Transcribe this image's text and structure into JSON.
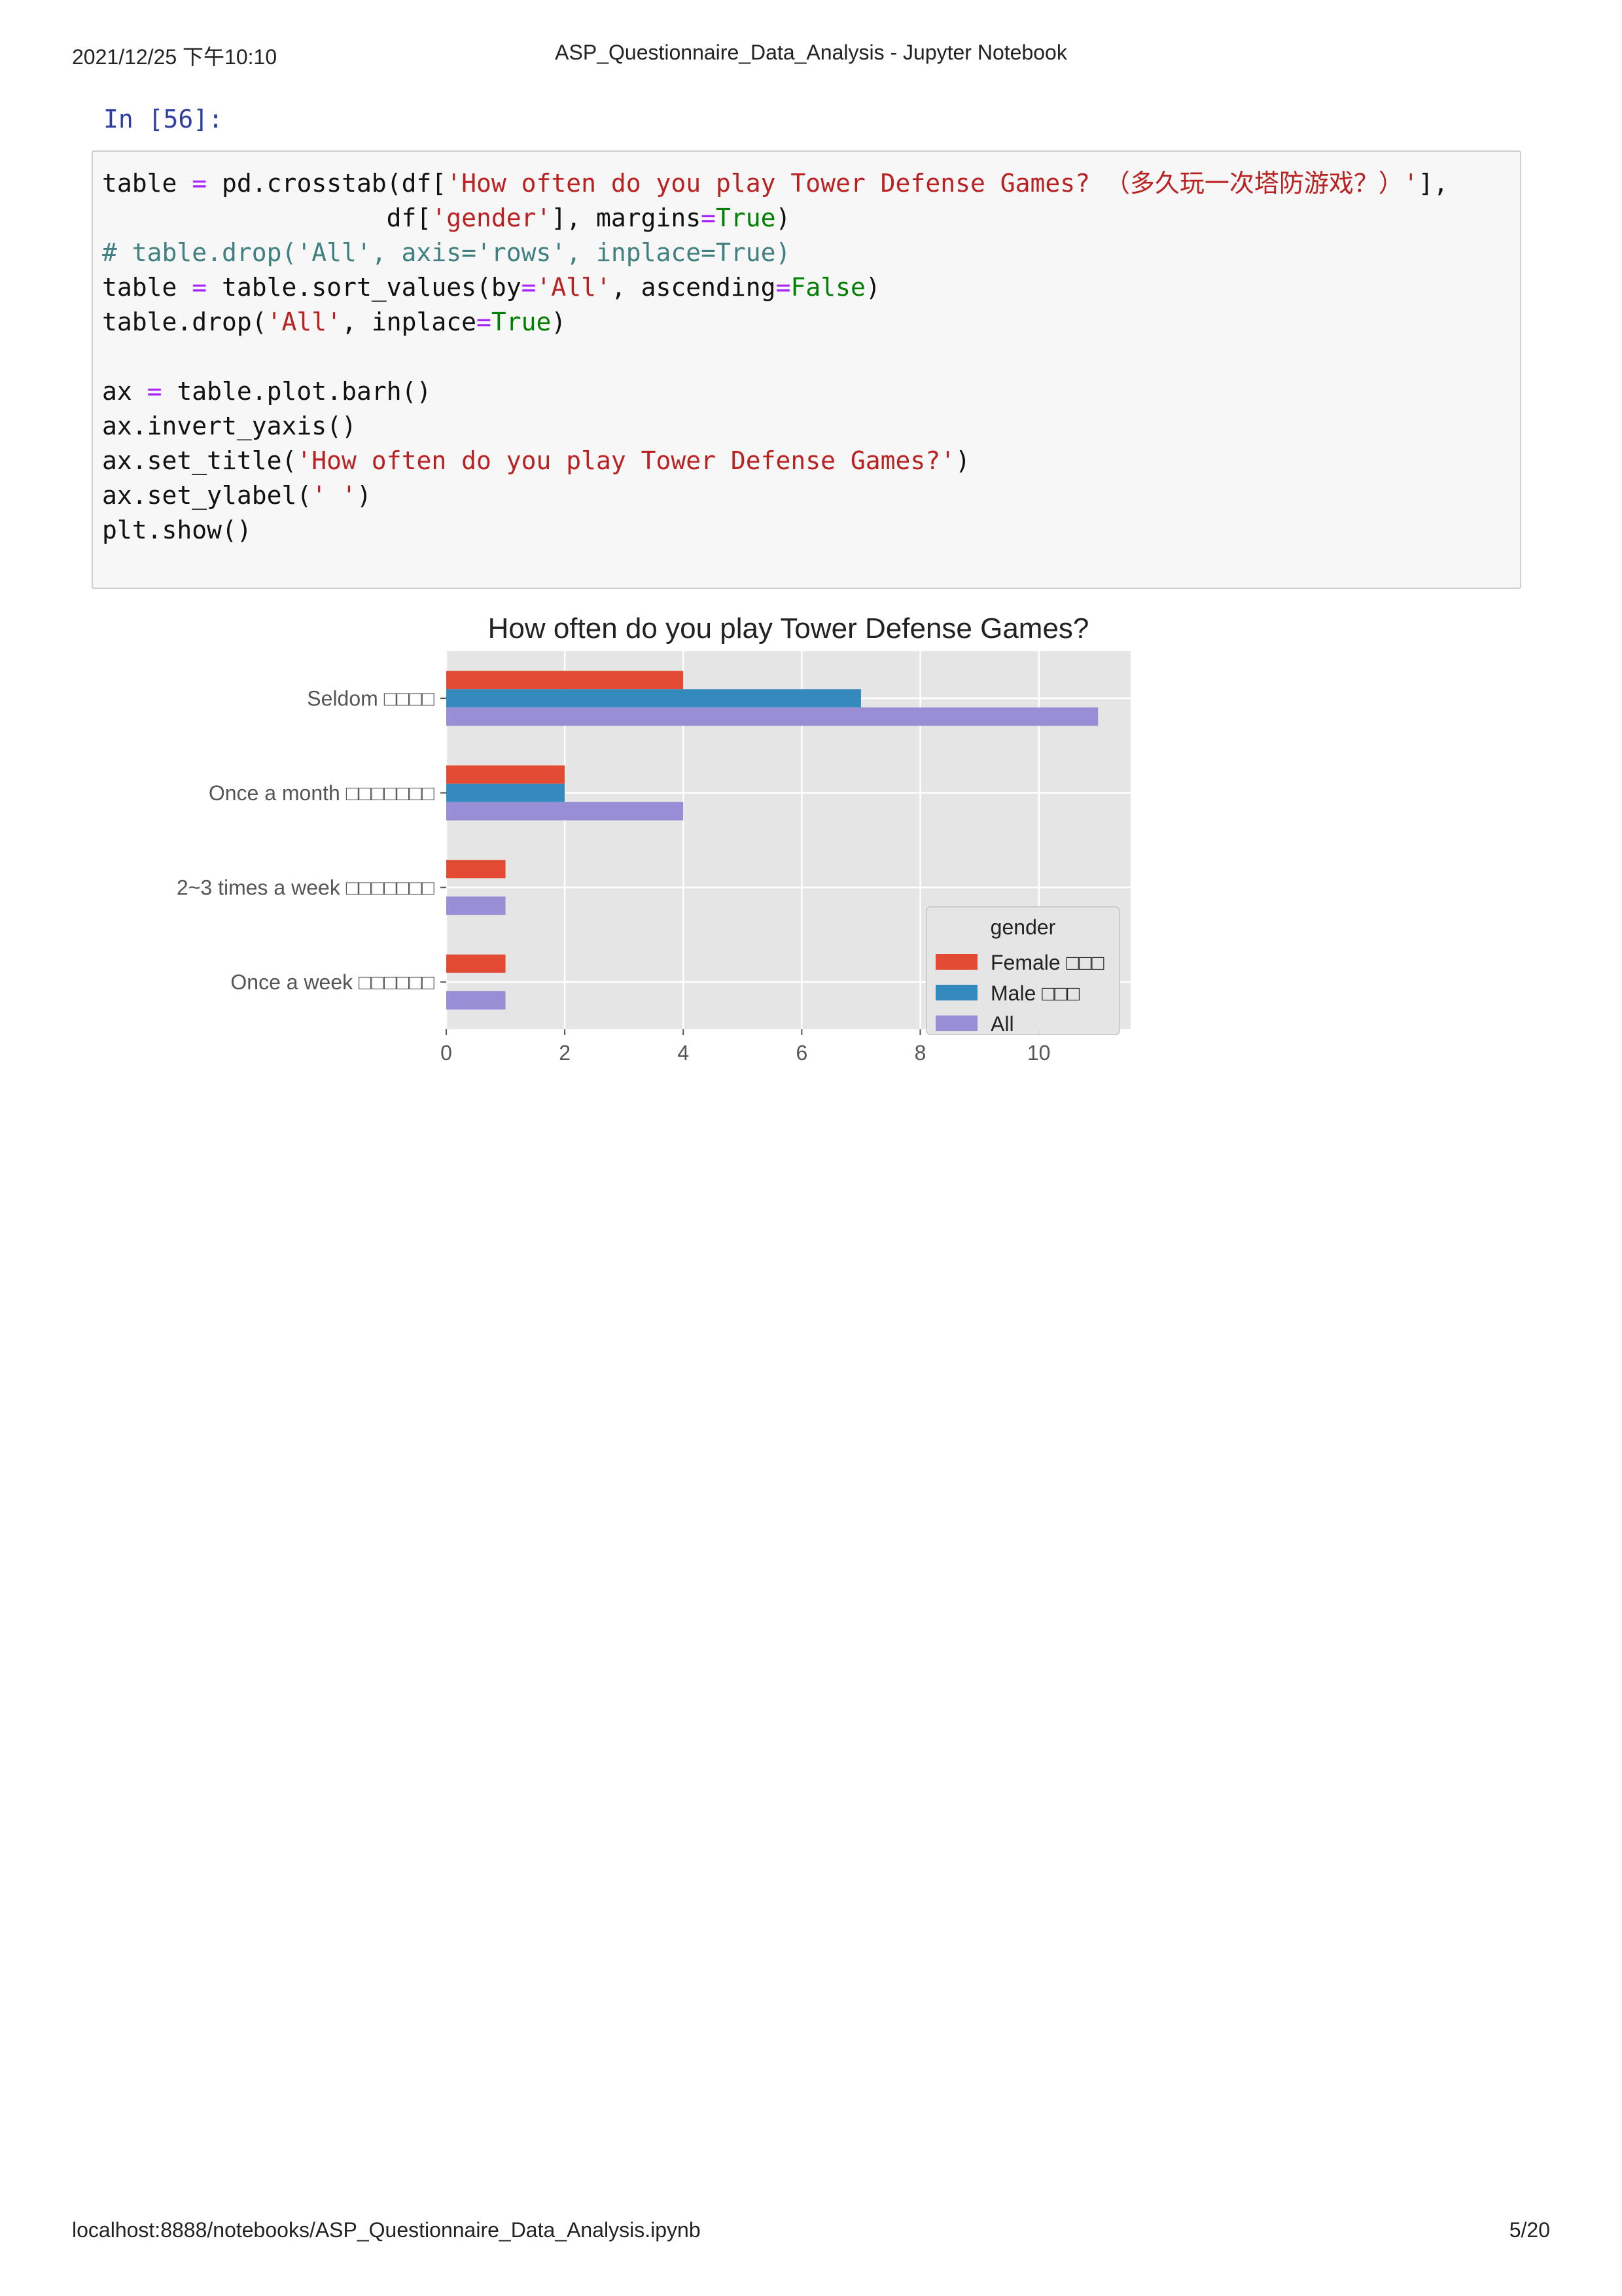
{
  "header": {
    "datetime": "2021/12/25 下午10:10",
    "title": "ASP_Questionnaire_Data_Analysis - Jupyter Notebook"
  },
  "footer": {
    "url": "localhost:8888/notebooks/ASP_Questionnaire_Data_Analysis.ipynb",
    "page": "5/20"
  },
  "cell": {
    "prompt": "In  [56]:",
    "code_lines": [
      [
        {
          "t": "table "
        },
        {
          "t": "=",
          "c": "op"
        },
        {
          "t": " pd.crosstab(df["
        },
        {
          "t": "'How often do you play Tower Defense Games? （多久玩一次塔防游戏？）'",
          "c": "str"
        },
        {
          "t": "],"
        }
      ],
      [
        {
          "t": "                   df["
        },
        {
          "t": "'gender'",
          "c": "str"
        },
        {
          "t": "], margins"
        },
        {
          "t": "=",
          "c": "op"
        },
        {
          "t": "True",
          "c": "kw"
        },
        {
          "t": ")"
        }
      ],
      [
        {
          "t": "# table.drop('All', axis='rows', inplace=True)",
          "c": "com"
        }
      ],
      [
        {
          "t": "table "
        },
        {
          "t": "=",
          "c": "op"
        },
        {
          "t": " table.sort_values(by"
        },
        {
          "t": "=",
          "c": "op"
        },
        {
          "t": "'All'",
          "c": "str"
        },
        {
          "t": ", ascending"
        },
        {
          "t": "=",
          "c": "op"
        },
        {
          "t": "False",
          "c": "kw"
        },
        {
          "t": ")"
        }
      ],
      [
        {
          "t": "table.drop("
        },
        {
          "t": "'All'",
          "c": "str"
        },
        {
          "t": ", inplace"
        },
        {
          "t": "=",
          "c": "op"
        },
        {
          "t": "True",
          "c": "kw"
        },
        {
          "t": ")"
        }
      ],
      [
        {
          "t": ""
        }
      ],
      [
        {
          "t": "ax "
        },
        {
          "t": "=",
          "c": "op"
        },
        {
          "t": " table.plot.barh()"
        }
      ],
      [
        {
          "t": "ax.invert_yaxis()"
        }
      ],
      [
        {
          "t": "ax.set_title("
        },
        {
          "t": "'How often do you play Tower Defense Games?'",
          "c": "str"
        },
        {
          "t": ")"
        }
      ],
      [
        {
          "t": "ax.set_ylabel("
        },
        {
          "t": "' '",
          "c": "str"
        },
        {
          "t": ")"
        }
      ],
      [
        {
          "t": "plt.show()"
        }
      ]
    ]
  },
  "chart_data": {
    "type": "bar",
    "orientation": "horizontal",
    "title": "How often do you play Tower Defense Games?",
    "categories": [
      "Seldom □□□□",
      "Once a month □□□□□□□",
      "2~3 times a week □□□□□□□",
      "Once a week □□□□□□"
    ],
    "series": [
      {
        "name": "Female □□□",
        "values": [
          4,
          2,
          1,
          1
        ],
        "color": "#e24a33"
      },
      {
        "name": "Male □□□",
        "values": [
          7,
          2,
          0,
          0
        ],
        "color": "#348abd"
      },
      {
        "name": "All",
        "values": [
          11,
          4,
          1,
          1
        ],
        "color": "#988ed5"
      }
    ],
    "xticks": [
      0,
      2,
      4,
      6,
      8,
      10
    ],
    "xlim": [
      0,
      11.55
    ],
    "legend_title": "gender",
    "legend_position": "lower-right",
    "grid": true,
    "background": "#e5e5e5"
  }
}
